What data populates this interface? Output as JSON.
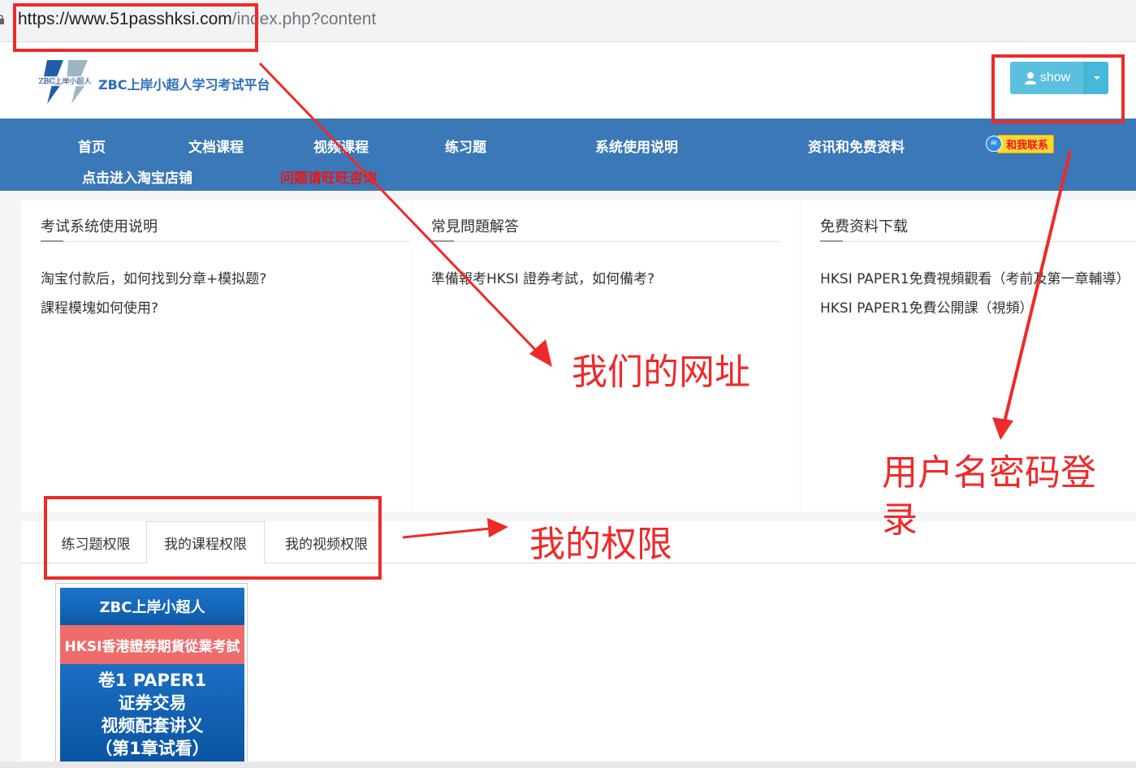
{
  "address_bar": {
    "url_host": "https://www.51passhksi.com",
    "url_path": "/index.php?content"
  },
  "header": {
    "site_name": "ZBC上岸小超人学习考试平台",
    "logo_text": "ZBC上岸小超人",
    "user_button_label": "show"
  },
  "nav": {
    "items": [
      "首页",
      "文档课程",
      "视频课程",
      "练习题",
      "系统使用说明",
      "资讯和免费资料"
    ],
    "contact_label": "和我联系",
    "taobao_label": "点击进入淘宝店铺",
    "ask_label": "问题请旺旺咨询"
  },
  "panels": [
    {
      "title": "考试系统使用说明",
      "links": [
        "淘宝付款后，如何找到分章+模拟题?",
        "課程模塊如何使用?"
      ]
    },
    {
      "title": "常見問題解答",
      "links": [
        "準備報考HKSI 證券考試，如何備考?"
      ]
    },
    {
      "title": "免费资料下载",
      "links": [
        "HKSI PAPER1免費視頻觀看（考前及第一章輔導）",
        "HKSI PAPER1免費公開課（視頻）"
      ]
    }
  ],
  "tabs": {
    "items": [
      "练习题权限",
      "我的课程权限",
      "我的视频权限"
    ],
    "active_index": 1
  },
  "cover": {
    "line1": "ZBC上岸小超人",
    "line2": "HKSI香港證券期貨從業考試",
    "line3": "卷1 PAPER1",
    "line4": "证券交易",
    "line5": "视频配套讲义",
    "line6": "（第1章试看）"
  },
  "annotations": {
    "url_note": "我们的网址",
    "login_note_line1": "用户名密码登",
    "login_note_line2": "录",
    "permission_note": "我的权限"
  },
  "colors": {
    "nav_bg": "#3a78b8",
    "annotation_red": "#ee2a2a",
    "user_button": "#5bc0de"
  }
}
